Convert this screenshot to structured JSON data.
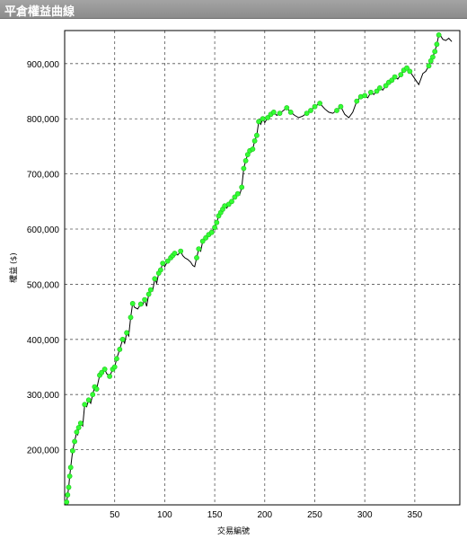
{
  "window": {
    "title": "平倉權益曲線"
  },
  "chart_data": {
    "type": "line",
    "title": "",
    "xlabel": "交易編號",
    "ylabel": "權益 ($)",
    "xlim": [
      0,
      395
    ],
    "ylim": [
      100000,
      960000
    ],
    "x_ticks": [
      50,
      100,
      150,
      200,
      250,
      300,
      350
    ],
    "x_tick_labels": [
      "50",
      "100",
      "150",
      "200",
      "250",
      "300",
      "350"
    ],
    "y_ticks": [
      200000,
      300000,
      400000,
      500000,
      600000,
      700000,
      800000,
      900000
    ],
    "y_tick_labels": [
      "200,000",
      "300,000",
      "400,000",
      "500,000",
      "600,000",
      "700,000",
      "800,000",
      "900,000"
    ],
    "grid": true,
    "line_color": "#000000",
    "marker_color": "#33ff33",
    "series": [
      {
        "points": [
          [
            2,
            105000
          ],
          [
            3,
            118000
          ],
          [
            4,
            132000
          ],
          [
            5,
            152000
          ],
          [
            6,
            168000
          ],
          [
            8,
            198000
          ],
          [
            10,
            215000
          ],
          [
            12,
            232000
          ],
          [
            13,
            226000
          ],
          [
            14,
            240000
          ],
          [
            16,
            248000
          ],
          [
            18,
            243000
          ],
          [
            20,
            282000
          ],
          [
            22,
            278000
          ],
          [
            24,
            290000
          ],
          [
            26,
            284000
          ],
          [
            28,
            300000
          ],
          [
            30,
            314000
          ],
          [
            32,
            310000
          ],
          [
            35,
            335000
          ],
          [
            37,
            340000
          ],
          [
            40,
            346000
          ],
          [
            42,
            338000
          ],
          [
            45,
            333000
          ],
          [
            48,
            346000
          ],
          [
            50,
            350000
          ],
          [
            52,
            365000
          ],
          [
            55,
            382000
          ],
          [
            58,
            400000
          ],
          [
            60,
            393000
          ],
          [
            62,
            412000
          ],
          [
            64,
            406000
          ],
          [
            66,
            440000
          ],
          [
            68,
            465000
          ],
          [
            70,
            458000
          ],
          [
            73,
            455000
          ],
          [
            76,
            464000
          ],
          [
            78,
            462000
          ],
          [
            80,
            472000
          ],
          [
            82,
            460000
          ],
          [
            84,
            482000
          ],
          [
            86,
            490000
          ],
          [
            88,
            488000
          ],
          [
            90,
            510000
          ],
          [
            92,
            502000
          ],
          [
            94,
            520000
          ],
          [
            96,
            526000
          ],
          [
            98,
            538000
          ],
          [
            100,
            532000
          ],
          [
            103,
            542000
          ],
          [
            106,
            548000
          ],
          [
            108,
            552000
          ],
          [
            110,
            556000
          ],
          [
            113,
            553000
          ],
          [
            116,
            560000
          ],
          [
            118,
            552000
          ],
          [
            120,
            548000
          ],
          [
            123,
            545000
          ],
          [
            126,
            540000
          ],
          [
            128,
            534000
          ],
          [
            130,
            532000
          ],
          [
            132,
            548000
          ],
          [
            134,
            564000
          ],
          [
            136,
            560000
          ],
          [
            138,
            578000
          ],
          [
            141,
            584000
          ],
          [
            144,
            590000
          ],
          [
            147,
            594000
          ],
          [
            150,
            603000
          ],
          [
            152,
            612000
          ],
          [
            154,
            624000
          ],
          [
            156,
            630000
          ],
          [
            158,
            636000
          ],
          [
            160,
            642000
          ],
          [
            162,
            638000
          ],
          [
            164,
            645000
          ],
          [
            167,
            650000
          ],
          [
            170,
            658000
          ],
          [
            173,
            664000
          ],
          [
            175,
            662000
          ],
          [
            177,
            676000
          ],
          [
            179,
            710000
          ],
          [
            181,
            724000
          ],
          [
            183,
            735000
          ],
          [
            185,
            742000
          ],
          [
            188,
            745000
          ],
          [
            190,
            760000
          ],
          [
            192,
            770000
          ],
          [
            194,
            795000
          ],
          [
            196,
            790000
          ],
          [
            198,
            800000
          ],
          [
            200,
            793000
          ],
          [
            203,
            802000
          ],
          [
            206,
            808000
          ],
          [
            209,
            812000
          ],
          [
            212,
            806000
          ],
          [
            215,
            810000
          ],
          [
            218,
            814000
          ],
          [
            222,
            820000
          ],
          [
            226,
            812000
          ],
          [
            230,
            806000
          ],
          [
            234,
            802000
          ],
          [
            238,
            805000
          ],
          [
            242,
            810000
          ],
          [
            246,
            815000
          ],
          [
            250,
            822000
          ],
          [
            255,
            828000
          ],
          [
            260,
            818000
          ],
          [
            264,
            812000
          ],
          [
            268,
            810000
          ],
          [
            272,
            815000
          ],
          [
            276,
            822000
          ],
          [
            280,
            808000
          ],
          [
            284,
            802000
          ],
          [
            288,
            812000
          ],
          [
            292,
            832000
          ],
          [
            296,
            840000
          ],
          [
            300,
            842000
          ],
          [
            303,
            838000
          ],
          [
            306,
            848000
          ],
          [
            309,
            844000
          ],
          [
            312,
            850000
          ],
          [
            315,
            856000
          ],
          [
            318,
            852000
          ],
          [
            321,
            860000
          ],
          [
            324,
            866000
          ],
          [
            327,
            870000
          ],
          [
            330,
            876000
          ],
          [
            333,
            872000
          ],
          [
            336,
            880000
          ],
          [
            339,
            888000
          ],
          [
            342,
            892000
          ],
          [
            345,
            886000
          ],
          [
            348,
            878000
          ],
          [
            351,
            870000
          ],
          [
            354,
            862000
          ],
          [
            356,
            872000
          ],
          [
            358,
            882000
          ],
          [
            361,
            886000
          ],
          [
            364,
            896000
          ],
          [
            366,
            905000
          ],
          [
            368,
            912000
          ],
          [
            370,
            922000
          ],
          [
            372,
            935000
          ],
          [
            374,
            952000
          ],
          [
            376,
            950000
          ],
          [
            378,
            944000
          ],
          [
            381,
            942000
          ],
          [
            384,
            946000
          ],
          [
            387,
            940000
          ]
        ],
        "markers_x": [
          2,
          3,
          4,
          5,
          6,
          8,
          10,
          12,
          14,
          16,
          20,
          24,
          28,
          30,
          32,
          35,
          37,
          40,
          45,
          48,
          50,
          52,
          55,
          58,
          62,
          66,
          68,
          76,
          80,
          84,
          86,
          90,
          94,
          96,
          98,
          103,
          106,
          108,
          110,
          116,
          132,
          134,
          138,
          141,
          144,
          147,
          150,
          152,
          154,
          156,
          158,
          160,
          164,
          167,
          170,
          173,
          177,
          179,
          181,
          183,
          185,
          188,
          190,
          192,
          194,
          198,
          203,
          206,
          209,
          215,
          222,
          226,
          242,
          246,
          250,
          255,
          272,
          276,
          292,
          296,
          300,
          306,
          312,
          315,
          321,
          324,
          327,
          330,
          336,
          339,
          342,
          345,
          364,
          366,
          368,
          370,
          372,
          374
        ]
      }
    ]
  }
}
